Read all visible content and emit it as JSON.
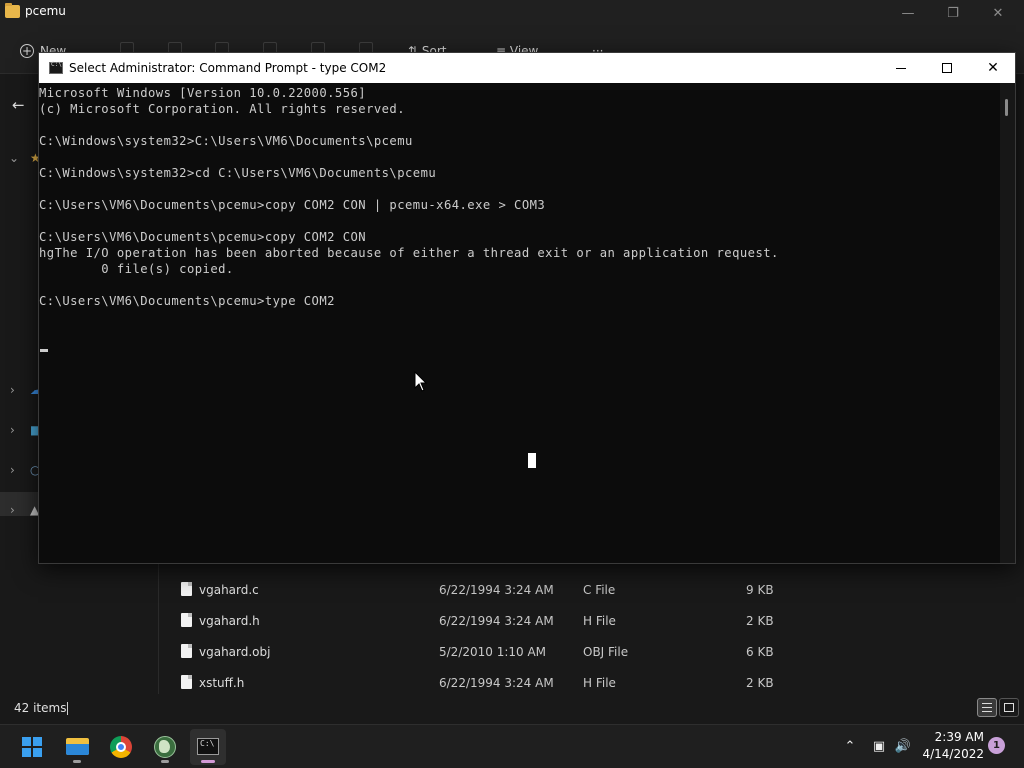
{
  "explorer": {
    "title": "pcemu",
    "toolbar": {
      "new_label": "New",
      "sort_label": "Sort",
      "view_label": "View",
      "more_label": "···"
    },
    "files": [
      {
        "name": "vgahard.c",
        "date": "6/22/1994 3:24 AM",
        "type": "C File",
        "size": "9 KB"
      },
      {
        "name": "vgahard.h",
        "date": "6/22/1994 3:24 AM",
        "type": "H File",
        "size": "2 KB"
      },
      {
        "name": "vgahard.obj",
        "date": "5/2/2010 1:10 AM",
        "type": "OBJ File",
        "size": "6 KB"
      },
      {
        "name": "xstuff.h",
        "date": "6/22/1994 3:24 AM",
        "type": "H File",
        "size": "2 KB"
      }
    ],
    "status": {
      "item_count": "42 items"
    }
  },
  "cmd": {
    "title": "Select Administrator: Command Prompt - type  COM2",
    "lines": [
      "Microsoft Windows [Version 10.0.22000.556]",
      "(c) Microsoft Corporation. All rights reserved.",
      "",
      "C:\\Windows\\system32>C:\\Users\\VM6\\Documents\\pcemu",
      "",
      "C:\\Windows\\system32>cd C:\\Users\\VM6\\Documents\\pcemu",
      "",
      "C:\\Users\\VM6\\Documents\\pcemu>copy COM2 CON | pcemu-x64.exe > COM3",
      "",
      "C:\\Users\\VM6\\Documents\\pcemu>copy COM2 CON",
      "hgThe I/O operation has been aborted because of either a thread exit or an application request.",
      "        0 file(s) copied.",
      "",
      "C:\\Users\\VM6\\Documents\\pcemu>type COM2"
    ]
  },
  "taskbar": {
    "clock_time": "2:39 AM",
    "clock_date": "4/14/2022",
    "notification_count": "1"
  },
  "colors": {
    "console_bg": "#0c0c0c",
    "console_text": "#cccccc",
    "taskbar_bg": "#1f1f1f",
    "active_app_indicator": "#d39ad6"
  }
}
